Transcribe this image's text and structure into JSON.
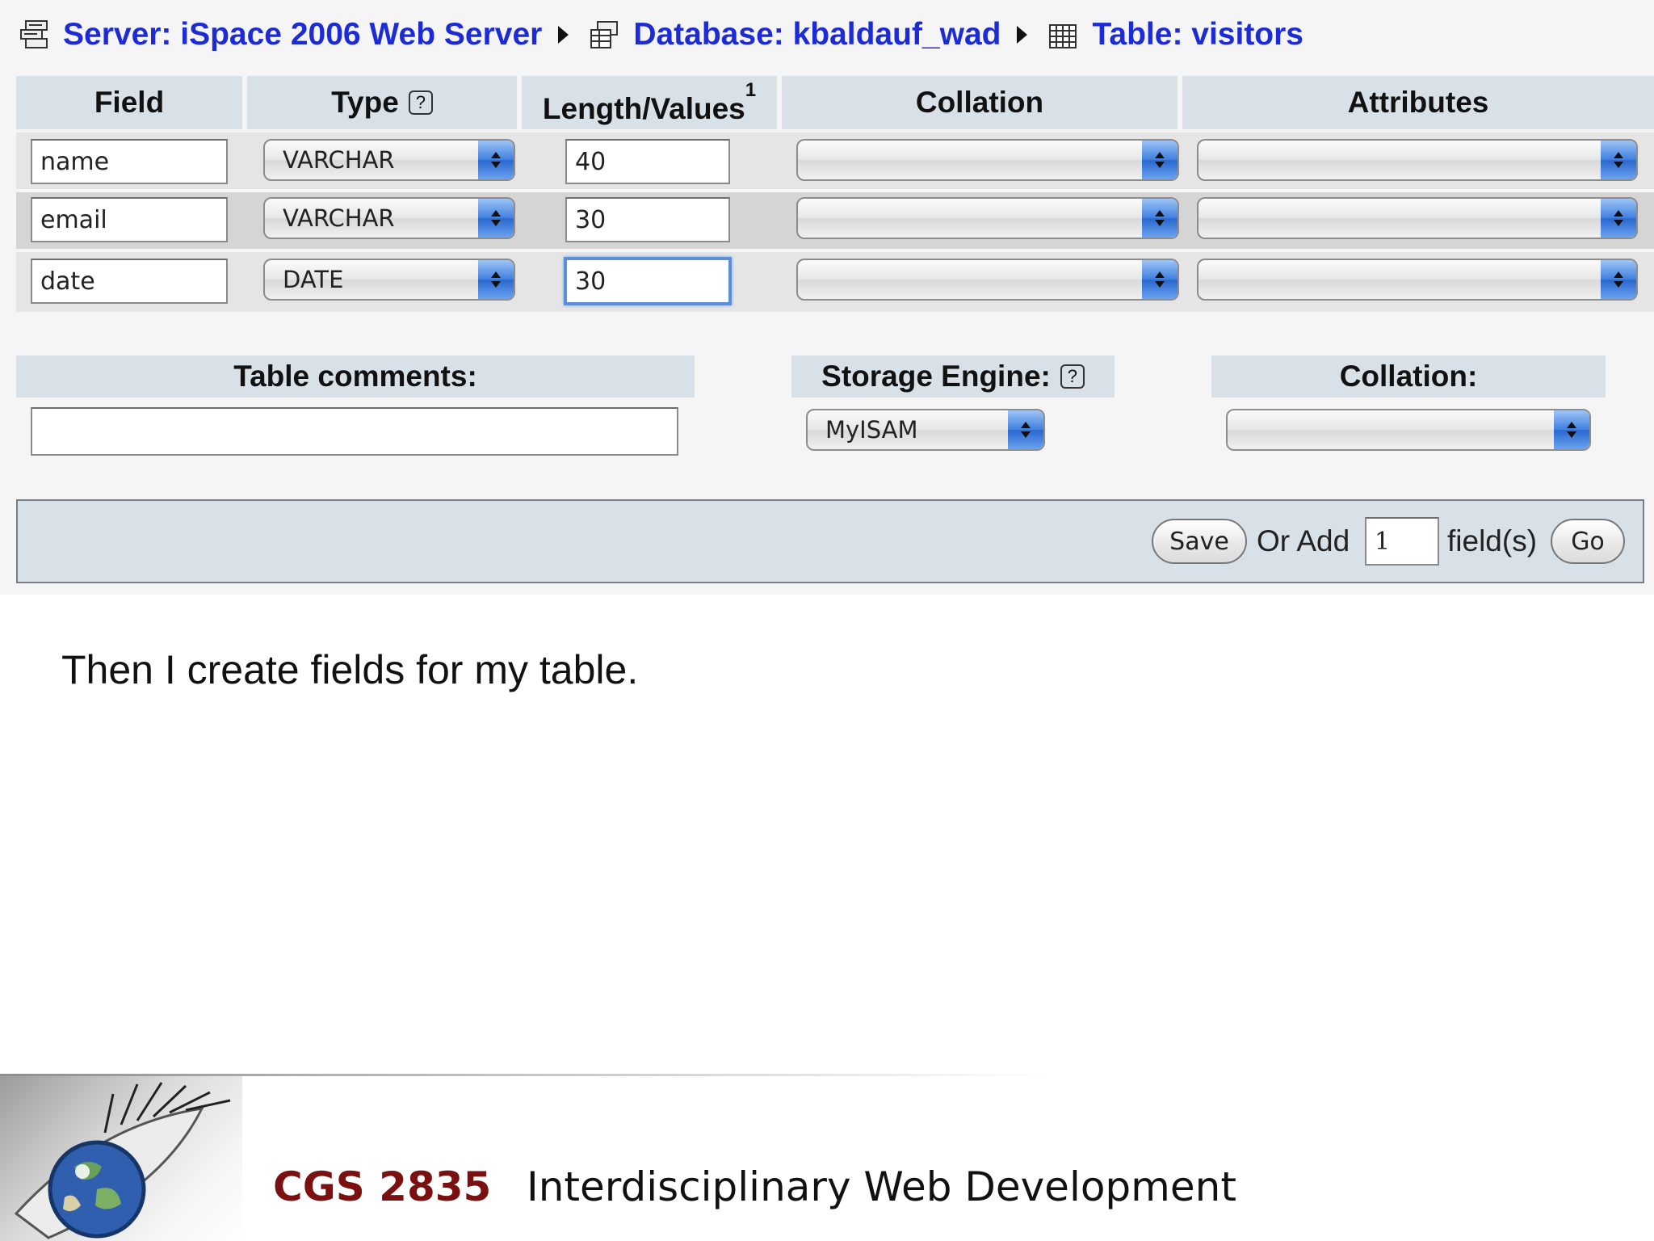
{
  "breadcrumb": {
    "server": "Server: iSpace 2006 Web Server",
    "database": "Database: kbaldauf_wad",
    "table": "Table: visitors"
  },
  "columns": {
    "field": "Field",
    "type": "Type",
    "length": "Length/Values",
    "length_sup": "1",
    "collation": "Collation",
    "attributes": "Attributes"
  },
  "rows": [
    {
      "field": "name",
      "type": "VARCHAR",
      "length": "40",
      "collation": "",
      "attributes": ""
    },
    {
      "field": "email",
      "type": "VARCHAR",
      "length": "30",
      "collation": "",
      "attributes": ""
    },
    {
      "field": "date",
      "type": "DATE",
      "length": "30",
      "collation": "",
      "attributes": ""
    }
  ],
  "table_options": {
    "comments_label": "Table comments:",
    "comments_value": "",
    "engine_label": "Storage Engine:",
    "engine_value": "MyISAM",
    "collation_label": "Collation:",
    "collation_value": ""
  },
  "actions": {
    "save": "Save",
    "or_add": "Or Add",
    "add_count": "1",
    "fields_suffix": "field(s)",
    "go": "Go"
  },
  "icons": {
    "help": "help-icon",
    "server": "server-icon",
    "database": "database-icon",
    "table": "table-icon"
  },
  "slide": {
    "caption": "Then I create fields for my table.",
    "course_code": "CGS 2835",
    "course_title": "Interdisciplinary Web Development"
  },
  "colors": {
    "link": "#1d2bd6",
    "header_bg": "#d8e0e8",
    "course_code": "#7a1010"
  }
}
